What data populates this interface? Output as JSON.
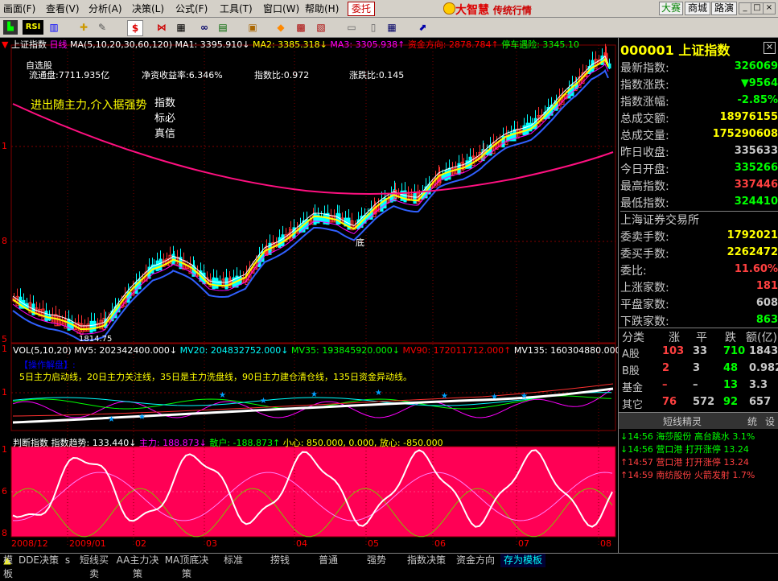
{
  "menubar": {
    "items": [
      "画面(F)",
      "查看(V)",
      "分析(A)",
      "决策(L)",
      "公式(F)",
      "工具(T)",
      "窗口(W)",
      "帮助(H)"
    ],
    "entrust": "委托",
    "logo": "大智慧",
    "logo_sub": "传统行情",
    "right_buttons": [
      "大赛",
      "商城",
      "路演"
    ],
    "window_buttons": [
      "_",
      "□",
      "×"
    ]
  },
  "toolbar": {
    "rsi_label": "RSI",
    "dollar_label": "$"
  },
  "chart": {
    "header": {
      "index_name": "上证指数",
      "period": "日线",
      "ma_params": "MA(5,10,20,30,60,120)",
      "ma1": "MA1: 3395.910↓",
      "ma2": "MA2: 3385.318↓",
      "ma3": "MA3: 3305.938↑",
      "fund_dir": "资金方向: 2878.784↑",
      "extra": "停车遇险: 3345.10"
    },
    "info": {
      "title": "自选股",
      "circ": "流通盘:7711.935亿",
      "roe": "净资收益率:6.346%",
      "index_ratio": "指数比:0.972",
      "updown_ratio": "涨跌比:0.145"
    },
    "slogan": "进出随主力,介入据强势",
    "tags": [
      "指数",
      "标必",
      "真信"
    ],
    "low_label": "1814.75",
    "bottom_label": "底",
    "left_axis": [
      "1",
      "8",
      "5"
    ],
    "vol": {
      "params": "VOL(5,10,20)",
      "mv5": "MV5: 202342400.000↓",
      "mv20": "MV20: 204832752.000↓",
      "mv35": "MV35: 193845920.000↓",
      "mv90": "MV90: 172011712.000↑",
      "mv135": "MV135: 160304880.000↑,",
      "hint_title": "【操作解盘】:",
      "hint_text": "5日主力启动线，20日主力关注线，35日是主力洗盘线，90日主力建仓清仓线，135日资金异动线。",
      "axis": [
        "1",
        "1"
      ]
    },
    "trend": {
      "name": "判断指数",
      "trend": "指数趋势: 133.440↓",
      "main": "主力: 188.873↓",
      "retail": "散户: -188.873↑",
      "careful": "小心: 850.000, 0.000, 放心: -850.000",
      "axis": [
        "1",
        "6",
        "8"
      ]
    },
    "x_labels": [
      "2008/12",
      "2009/01",
      "02",
      "03",
      "04",
      "05",
      "06",
      "07",
      "08"
    ]
  },
  "quote": {
    "code": "000001",
    "name": "上证指数",
    "rows": [
      {
        "label": "最新指数:",
        "value": "326069",
        "color": "#00ff00"
      },
      {
        "label": "指数涨跌:",
        "value": "▼9564",
        "color": "#00ff00"
      },
      {
        "label": "指数涨幅:",
        "value": "-2.85%",
        "color": "#00ff00"
      },
      {
        "label": "总成交额:",
        "value": "18976155",
        "color": "#ffff00"
      },
      {
        "label": "总成交量:",
        "value": "175290608",
        "color": "#ffff00"
      },
      {
        "label": "昨日收盘:",
        "value": "335633",
        "color": "#c8c8c8"
      },
      {
        "label": "今日开盘:",
        "value": "335266",
        "color": "#00ff00"
      },
      {
        "label": "最高指数:",
        "value": "337446",
        "color": "#ff4040"
      },
      {
        "label": "最低指数:",
        "value": "324410",
        "color": "#00ff00"
      }
    ],
    "exchange": "上海证券交易所",
    "rows2": [
      {
        "label": "委卖手数:",
        "value": "1792021",
        "color": "#ffff00"
      },
      {
        "label": "委买手数:",
        "value": "2262472",
        "color": "#ffff00"
      },
      {
        "label": "委比:",
        "value": "11.60%",
        "color": "#ff4040"
      },
      {
        "label": "上涨家数:",
        "value": "181",
        "color": "#ff4040"
      },
      {
        "label": "平盘家数:",
        "value": "608",
        "color": "#c8c8c8"
      },
      {
        "label": "下跌家数:",
        "value": "863",
        "color": "#00ff00"
      }
    ],
    "table_header": [
      "分类",
      "涨",
      "平",
      "跌",
      "额(亿)"
    ],
    "table_rows": [
      {
        "name": "A股",
        "up": "103",
        "flat": "33",
        "down": "710",
        "amt": "1843"
      },
      {
        "name": "B股",
        "up": "2",
        "flat": "3",
        "down": "48",
        "amt": "0.982"
      },
      {
        "name": "基金",
        "up": "–",
        "flat": "–",
        "down": "13",
        "amt": "3.3"
      },
      {
        "name": "其它",
        "up": "76",
        "flat": "572",
        "down": "92",
        "amt": "657"
      }
    ]
  },
  "sprite": {
    "title": "短线精灵",
    "btn1": "统",
    "btn2": "设",
    "alerts": [
      {
        "time": "14:56",
        "stock": "海莎股份",
        "event": "高台跳水",
        "pct": "3.1%",
        "dir": "down"
      },
      {
        "time": "14:56",
        "stock": "营口港",
        "event": "打开涨停",
        "pct": "13.24",
        "dir": "down"
      },
      {
        "time": "14:57",
        "stock": "营口港",
        "event": "打开涨停",
        "pct": "13.24",
        "dir": "up"
      },
      {
        "time": "14:59",
        "stock": "南纺股份",
        "event": "火箭发射",
        "pct": "1.7%",
        "dir": "up"
      }
    ]
  },
  "tabs": [
    "模板",
    "DDE决策",
    "s",
    "短线买卖",
    "AA主力决策",
    "MA顶底决策",
    "标准",
    "捞钱",
    "普通",
    "强势",
    "指数决策",
    "资金方向",
    "存为模板"
  ]
}
